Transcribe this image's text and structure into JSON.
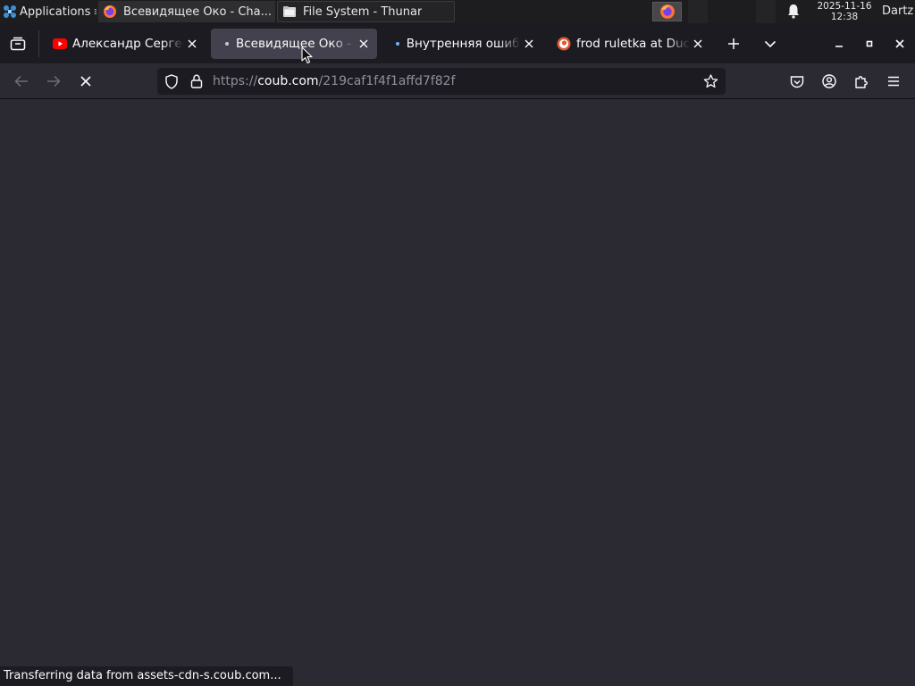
{
  "panel": {
    "applications_label": "Applications",
    "windows": [
      {
        "title": "Всевидящее Око - Cha...",
        "icon": "firefox-icon"
      },
      {
        "title": "File System - Thunar",
        "icon": "folder-icon"
      }
    ],
    "clock_date": "2025-11-16",
    "clock_time": "12:38",
    "user": "Dartz"
  },
  "tabs": [
    {
      "label": "Александр Сергее",
      "icon": "youtube-icon",
      "selected": false
    },
    {
      "label": "Всевидящее Око -",
      "icon": "loading-dot",
      "selected": true
    },
    {
      "label": "Внутренняя ошибк",
      "icon": "loading-dot",
      "selected": false
    },
    {
      "label": "frod ruletka at Duck",
      "icon": "duckduckgo-icon",
      "selected": false
    }
  ],
  "address": {
    "scheme": "https://",
    "host": "coub.com",
    "path": "/219caf1f4f1affd7f82f"
  },
  "status_text": "Transferring data from assets-cdn-s.coub.com...",
  "colors": {
    "chrome_dark": "#1c1b22",
    "toolbar": "#2b2a33",
    "selected_tab": "#42414d",
    "text": "#fbfbfe"
  }
}
